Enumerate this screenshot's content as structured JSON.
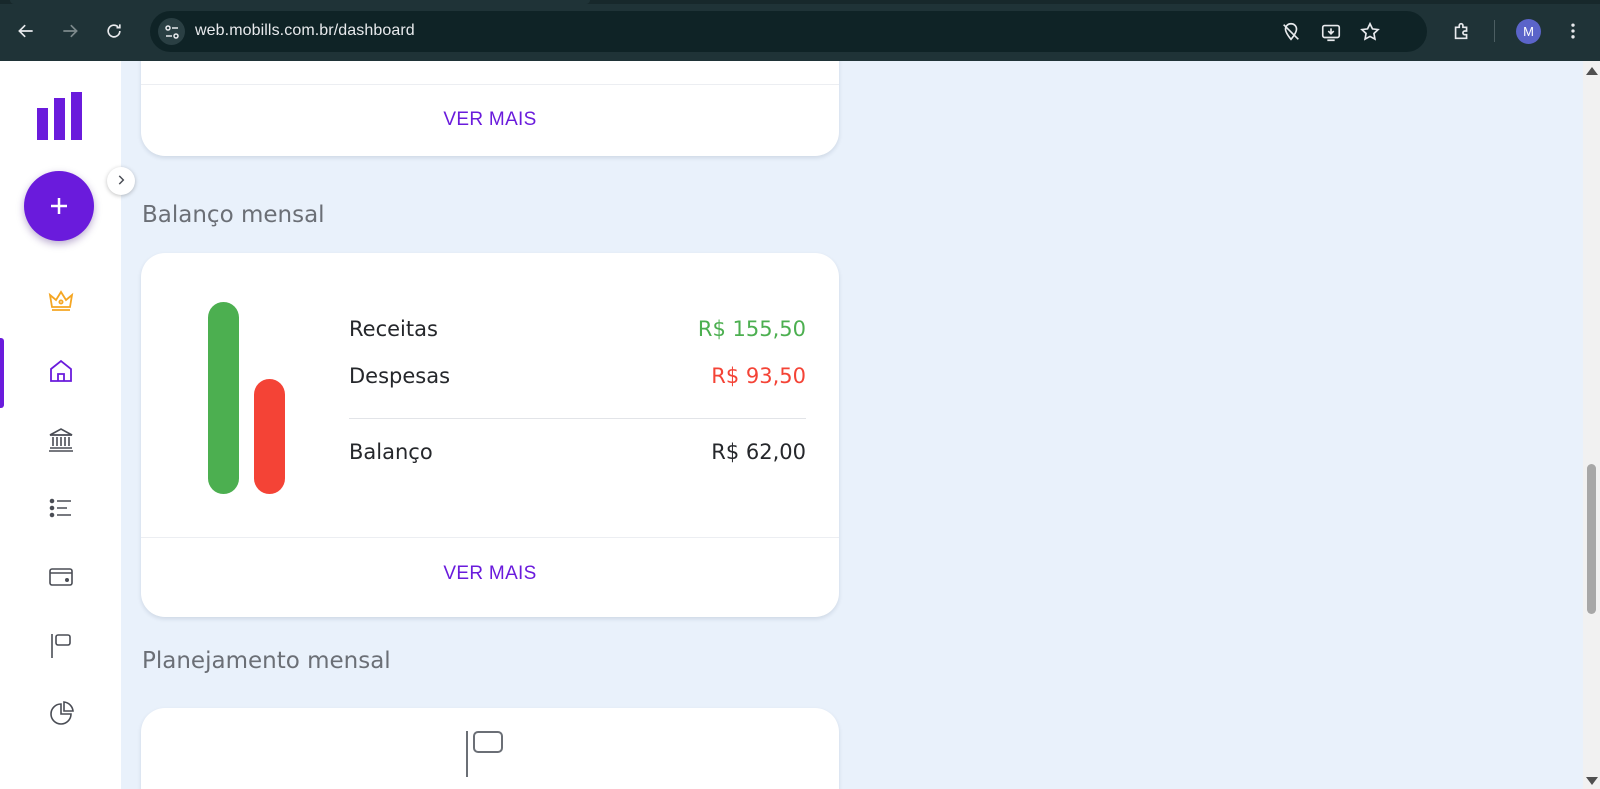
{
  "browser": {
    "url": "web.mobills.com.br/dashboard",
    "profile_initial": "M",
    "icons": [
      "back-icon",
      "forward-icon",
      "reload-icon",
      "site-info-icon",
      "tracking-protection-icon",
      "install-app-icon",
      "bookmark-star-icon",
      "extensions-icon",
      "menu-kebab-icon"
    ]
  },
  "sidebar": {
    "fab_label": "+",
    "items": [
      {
        "name": "premium",
        "icon": "crown-icon"
      },
      {
        "name": "home",
        "icon": "home-icon",
        "active": true
      },
      {
        "name": "accounts",
        "icon": "bank-icon"
      },
      {
        "name": "transactions",
        "icon": "list-icon"
      },
      {
        "name": "cards",
        "icon": "credit-card-icon"
      },
      {
        "name": "planning",
        "icon": "flag-icon"
      },
      {
        "name": "reports",
        "icon": "pie-chart-icon"
      }
    ]
  },
  "top_card": {
    "ver_mais": "VER MAIS"
  },
  "balance_section": {
    "title": "Balanço mensal",
    "income_label": "Receitas",
    "income_value": "R$ 155,50",
    "expense_label": "Despesas",
    "expense_value": "R$ 93,50",
    "balance_label": "Balanço",
    "balance_value": "R$ 62,00",
    "ver_mais": "VER MAIS",
    "chart": {
      "income_amount": 155.5,
      "expense_amount": 93.5
    }
  },
  "planning_section": {
    "title": "Planejamento mensal",
    "icon": "flag-icon"
  },
  "colors": {
    "accent": "#6a1bdc",
    "income": "#4caf50",
    "expense": "#f44336",
    "premium": "#f5a623",
    "chrome_bg": "#1f3337",
    "page_bg": "#e9f1fb"
  }
}
